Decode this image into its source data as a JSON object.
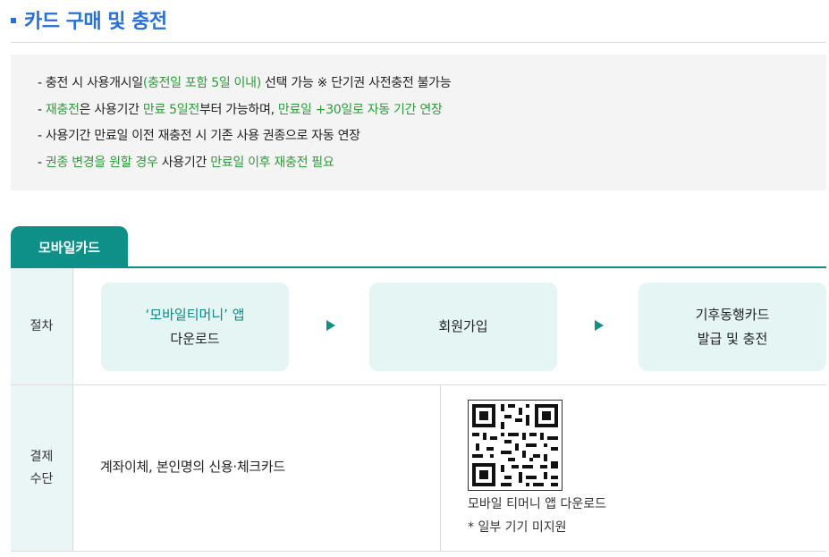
{
  "section": {
    "title": "카드 구매 및 충전"
  },
  "notice": {
    "line1": {
      "p1": "- 충전 시 사용개시일",
      "p2": "(충전일 포함 5일 이내)",
      "p3": " 선택 가능   ※ 단기권 사전충전 불가능"
    },
    "line2": {
      "p1": "- ",
      "p2": "재충전",
      "p3": "은 사용기간 ",
      "p4": "만료 5일전",
      "p5": "부터 가능하며, ",
      "p6": "만료일 +30일로 자동 기간 연장"
    },
    "line3": {
      "p1": "- 사용기간 만료일 이전 재충전 시 기존 사용 권종으로 자동 연장"
    },
    "line4": {
      "p1": "- ",
      "p2": "권종 변경을 원할 경우",
      "p3": " 사용기간 ",
      "p4": "만료일 이후 재충전 필요"
    }
  },
  "tab": {
    "label": "모바일카드"
  },
  "procedure": {
    "header": "절차",
    "steps": [
      {
        "line1": "‘모바일티머니’ 앱",
        "line2": "다운로드"
      },
      {
        "line1": "회원가입",
        "line2": ""
      },
      {
        "line1": "기후동행카드",
        "line2": "발급 및 충전"
      }
    ]
  },
  "payment": {
    "header_line1": "결제",
    "header_line2": "수단",
    "methods": "계좌이체, 본인명의 신용·체크카드",
    "qr_caption": "모바일 티머니 앱 다운로드",
    "qr_note": "*  일부 기기 미지원"
  },
  "colors": {
    "accent_blue": "#2670d6",
    "teal": "#0e9089",
    "green_highlight": "#2e9b3a"
  },
  "icons": {
    "qr": "qr-code-icon",
    "arrow": "triangle-right-icon"
  }
}
